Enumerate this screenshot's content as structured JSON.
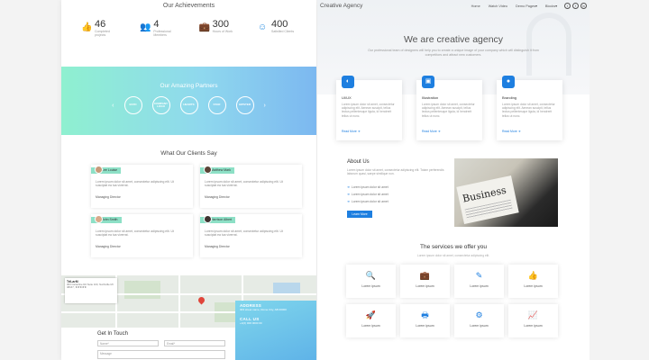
{
  "left": {
    "achievements_title": "Our Achievements",
    "achievements": [
      {
        "icon": "thumbs-up-icon",
        "glyph": "👍",
        "number": "46",
        "label": "Completed projects"
      },
      {
        "icon": "users-icon",
        "glyph": "👥",
        "number": "4",
        "label": "Professional Members"
      },
      {
        "icon": "briefcase-icon",
        "glyph": "💼",
        "number": "300",
        "label": "Hours of Work"
      },
      {
        "icon": "smile-icon",
        "glyph": "☺",
        "number": "400",
        "label": "Satisfied Clients"
      }
    ],
    "partners_title": "Our Amazing Partners",
    "partners": [
      "ESTD",
      "COMPANY LOGO",
      "HEARTS",
      "STAR",
      "HIPSTER"
    ],
    "clients_title": "What Our Clients Say",
    "testimonials": [
      {
        "name": "Lee Louise",
        "text": "Lorem ipsum dolor sit amet, consectetur adipiscing elit. Ut suscipiat ea tua viverrat.",
        "role": "Managing Director"
      },
      {
        "name": "Matthew Mark",
        "text": "Lorem ipsum dolor sit amet, consectetur adipiscing elit. Ut suscipiat ea tua viverrat.",
        "role": "Managing Director"
      },
      {
        "name": "John Smith",
        "text": "Lorem ipsum dolor sit amet, consectetur adipiscing elit. Ut suscipiat ea tua viverrat.",
        "role": "Managing Director"
      },
      {
        "name": "Harrison Albert",
        "text": "Lorem ipsum dolor sit amet, consectetur adipiscing elit. Ut suscipiat ea tua viverrat.",
        "role": "Managing Director"
      }
    ],
    "map_card_title": "TriLarM",
    "map_card_text": "303 Carterline Rd Suite 100, Northville MI 48167, ★★★★★",
    "contact_title": "Get In Touch",
    "name_placeholder": "Name*",
    "email_placeholder": "Email*",
    "message_placeholder": "Message",
    "address_heading": "ADDRESS",
    "address_text": "303 street name, Rome City, AB 00000",
    "call_heading": "CALL US",
    "call_text": "+1(0) 000 0000 00"
  },
  "right": {
    "brand": "Creative Agency",
    "nav": [
      "Home",
      "Watch Video",
      "Demo Pages▾",
      "Blocks▾"
    ],
    "social": [
      "t",
      "f",
      "in"
    ],
    "hero_title": "We are creative agency",
    "hero_sub": "Our professional team of designers will help you to create a unique image of your company which will distinguish it from competitors and attract new customers.",
    "features": [
      {
        "icon": "palette-icon",
        "glyph": "◐",
        "title": "UI/UX",
        "text": "Lorem ipsum dolor sit amet, consectetur adipiscing elit. Aenean suscipit, tellus lectus pellentesque ligula, id hendrerit tellus ut nunc.",
        "link": "Read More ➜"
      },
      {
        "icon": "illustration-icon",
        "glyph": "▣",
        "title": "Illustration",
        "text": "Lorem ipsum dolor sit amet, consectetur adipiscing elit. Aenean suscipit, tellus lectus pellentesque ligula, id hendrerit tellus ut nunc.",
        "link": "Read More ➜"
      },
      {
        "icon": "apple-icon",
        "glyph": "●",
        "title": "Branding",
        "text": "Lorem ipsum dolor sit amet, consectetur adipiscing elit. Aenean suscipit, tellus lectus pellentesque ligula, id hendrerit tellus ut nunc.",
        "link": "Read More ➜"
      }
    ],
    "about_title": "About Us",
    "about_text": "Lorem ipsum dolor sit amet, consectetur adipiscing elit. Totam perferendis laborum quasi, saepe similique non.",
    "about_list": [
      "Lorem ipsum dolor sit amet",
      "Lorem ipsum dolor sit amet",
      "Lorem ipsum dolor sit amet"
    ],
    "about_button": "Learn More",
    "about_image_word": "Business",
    "services_title": "The services we offer you",
    "services_sub": "Lorem ipsum dolor sit amet, consectetur adipiscing elit.",
    "services": [
      {
        "icon": "search-icon",
        "glyph": "🔍",
        "label": "Lorem ipsum"
      },
      {
        "icon": "briefcase-icon",
        "glyph": "💼",
        "label": "Lorem ipsum"
      },
      {
        "icon": "magic-wand-icon",
        "glyph": "✎",
        "label": "Lorem ipsum"
      },
      {
        "icon": "thumbs-up-icon",
        "glyph": "👍",
        "label": "Lorem ipsum"
      },
      {
        "icon": "rocket-icon",
        "glyph": "🚀",
        "label": "Lorem ipsum"
      },
      {
        "icon": "printer-icon",
        "glyph": "🖶",
        "label": "Lorem ipsum"
      },
      {
        "icon": "gears-icon",
        "glyph": "⚙",
        "label": "Lorem ipsum"
      },
      {
        "icon": "chart-icon",
        "glyph": "📈",
        "label": "Lorem ipsum"
      }
    ]
  }
}
